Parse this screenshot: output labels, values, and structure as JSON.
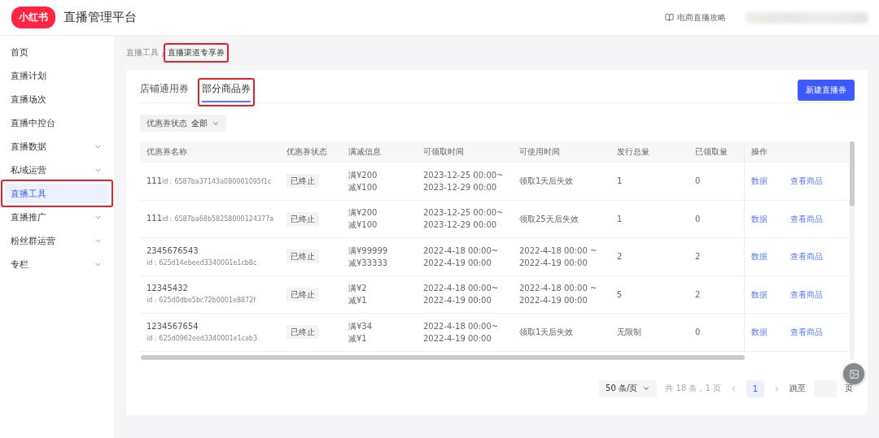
{
  "header": {
    "logo": "小红书",
    "title": "直播管理平台",
    "guide_link": "电商直播攻略"
  },
  "sidebar": {
    "items": [
      {
        "label": "首页",
        "expandable": false,
        "selected": false,
        "highlighted": false
      },
      {
        "label": "直播计划",
        "expandable": false,
        "selected": false,
        "highlighted": false
      },
      {
        "label": "直播场次",
        "expandable": false,
        "selected": false,
        "highlighted": false
      },
      {
        "label": "直播中控台",
        "expandable": false,
        "selected": false,
        "highlighted": false
      },
      {
        "label": "直播数据",
        "expandable": true,
        "selected": false,
        "highlighted": false
      },
      {
        "label": "私域运营",
        "expandable": true,
        "selected": false,
        "highlighted": false
      },
      {
        "label": "直播工具",
        "expandable": false,
        "selected": true,
        "highlighted": true
      },
      {
        "label": "直播推广",
        "expandable": true,
        "selected": false,
        "highlighted": false
      },
      {
        "label": "粉丝群运营",
        "expandable": true,
        "selected": false,
        "highlighted": false
      },
      {
        "label": "专栏",
        "expandable": true,
        "selected": false,
        "highlighted": false
      }
    ]
  },
  "breadcrumb_separator": "/",
  "breadcrumb": [
    {
      "label": "直播工具",
      "highlighted": false
    },
    {
      "label": "直播渠道专享券",
      "highlighted": true
    }
  ],
  "tabs": [
    {
      "label": "店铺通用券",
      "selected": false,
      "highlighted": false
    },
    {
      "label": "部分商品券",
      "selected": true,
      "highlighted": true
    }
  ],
  "new_button": "新建直播券",
  "filter": {
    "label": "优惠券状态",
    "value": "全部"
  },
  "table": {
    "columns": [
      "优惠券名称",
      "优惠券状态",
      "满减信息",
      "可领取时间",
      "可使用时间",
      "发行总量",
      "已领取量",
      "操作"
    ],
    "rows": [
      {
        "name": "111",
        "id": "id：6587ba37143a080001095f1c",
        "kind": "inline",
        "status": "已终止",
        "threshold": "满¥200",
        "discount": "减¥100",
        "claim_time": [
          "2023-12-25 00:00~",
          "2023-12-29 00:00"
        ],
        "use_time": [
          "领取1天后失效"
        ],
        "total": "1",
        "claimed": "0",
        "actions": [
          "数据",
          "查看商品"
        ]
      },
      {
        "name": "111",
        "id": "id：6587ba68b58258000124377a",
        "kind": "inline",
        "status": "已终止",
        "threshold": "满¥200",
        "discount": "减¥100",
        "claim_time": [
          "2023-12-25 00:00~",
          "2023-12-29 00:00"
        ],
        "use_time": [
          "领取25天后失效"
        ],
        "total": "1",
        "claimed": "0",
        "actions": [
          "数据",
          "查看商品"
        ]
      },
      {
        "name": "2345676543",
        "id": "id：625d14ebeed3340001e1cb8c",
        "kind": "stacked",
        "status": "已终止",
        "threshold": "满¥99999",
        "discount": "减¥33333",
        "claim_time": [
          "2022-4-18 00:00~",
          "2022-4-19 00:00"
        ],
        "use_time": [
          "2022-4-18 00:00 ~",
          "2022-4-19 00:00"
        ],
        "total": "2",
        "claimed": "2",
        "actions": [
          "数据",
          "查看商品"
        ]
      },
      {
        "name": "12345432",
        "id": "id：625d0dbe5bc72b0001e8872f",
        "kind": "stacked",
        "status": "已终止",
        "threshold": "满¥2",
        "discount": "减¥1",
        "claim_time": [
          "2022-4-18 00:00~",
          "2022-4-19 00:00"
        ],
        "use_time": [
          "2022-4-18 00:00 ~",
          "2022-4-19 00:00"
        ],
        "total": "5",
        "claimed": "2",
        "actions": [
          "数据",
          "查看商品"
        ]
      },
      {
        "name": "1234567654",
        "id": "id：625d0962eed3340001e1cab3",
        "kind": "stacked",
        "status": "已终止",
        "threshold": "满¥34",
        "discount": "减¥1",
        "claim_time": [
          "2022-4-18 00:00~",
          "2022-4-19 00:00"
        ],
        "use_time": [
          "领取1天后失效"
        ],
        "total": "无限制",
        "claimed": "0",
        "actions": [
          "数据",
          "查看商品"
        ]
      }
    ]
  },
  "pagination": {
    "page_size": "50 条/页",
    "summary": "共 18 条，1 页",
    "pages": [
      {
        "label": "1",
        "selected": true
      }
    ],
    "jump_label": "跳至",
    "jump_suffix": "页"
  }
}
